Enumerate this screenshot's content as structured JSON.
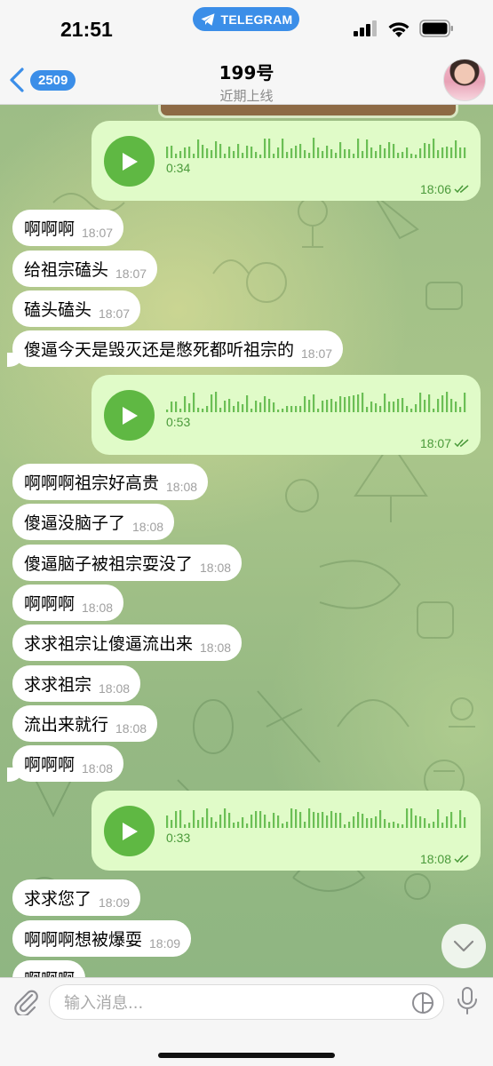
{
  "status_bar": {
    "time": "21:51",
    "app_pill": "TELEGRAM"
  },
  "header": {
    "back_count": "2509",
    "title": "199号",
    "subtitle": "近期上线"
  },
  "messages": [
    {
      "type": "voice",
      "duration": "0:34",
      "time": "18:06",
      "read": true
    },
    {
      "type": "text",
      "text": "啊啊啊",
      "time": "18:07"
    },
    {
      "type": "text",
      "text": "给祖宗磕头",
      "time": "18:07"
    },
    {
      "type": "text",
      "text": "磕头磕头",
      "time": "18:07"
    },
    {
      "type": "text",
      "text": "傻逼今天是毁灭还是憋死都听祖宗的",
      "time": "18:07"
    },
    {
      "type": "voice",
      "duration": "0:53",
      "time": "18:07",
      "read": true
    },
    {
      "type": "text",
      "text": "啊啊啊祖宗好高贵",
      "time": "18:08"
    },
    {
      "type": "text",
      "text": "傻逼没脑子了",
      "time": "18:08"
    },
    {
      "type": "text",
      "text": "傻逼脑子被祖宗耍没了",
      "time": "18:08"
    },
    {
      "type": "text",
      "text": "啊啊啊",
      "time": "18:08"
    },
    {
      "type": "text",
      "text": "求求祖宗让傻逼流出来",
      "time": "18:08"
    },
    {
      "type": "text",
      "text": "求求祖宗",
      "time": "18:08"
    },
    {
      "type": "text",
      "text": "流出来就行",
      "time": "18:08"
    },
    {
      "type": "text",
      "text": "啊啊啊",
      "time": "18:08"
    },
    {
      "type": "voice",
      "duration": "0:33",
      "time": "18:08",
      "read": true
    },
    {
      "type": "text",
      "text": "求求您了",
      "time": "18:09"
    },
    {
      "type": "text",
      "text": "啊啊啊想被爆耍",
      "time": "18:09"
    },
    {
      "type": "text",
      "text": "啊啊啊",
      "time": ""
    }
  ],
  "input": {
    "placeholder": "输入消息..."
  },
  "icons": {
    "attach": "paperclip-icon",
    "sticker": "sticker-icon",
    "mic": "microphone-icon",
    "scroll": "chevron-down-icon"
  },
  "colors": {
    "accent": "#3b8ee8",
    "outgoing_bubble": "#e0fbc8",
    "play_button": "#5fb843",
    "incoming_bubble": "#ffffff"
  }
}
